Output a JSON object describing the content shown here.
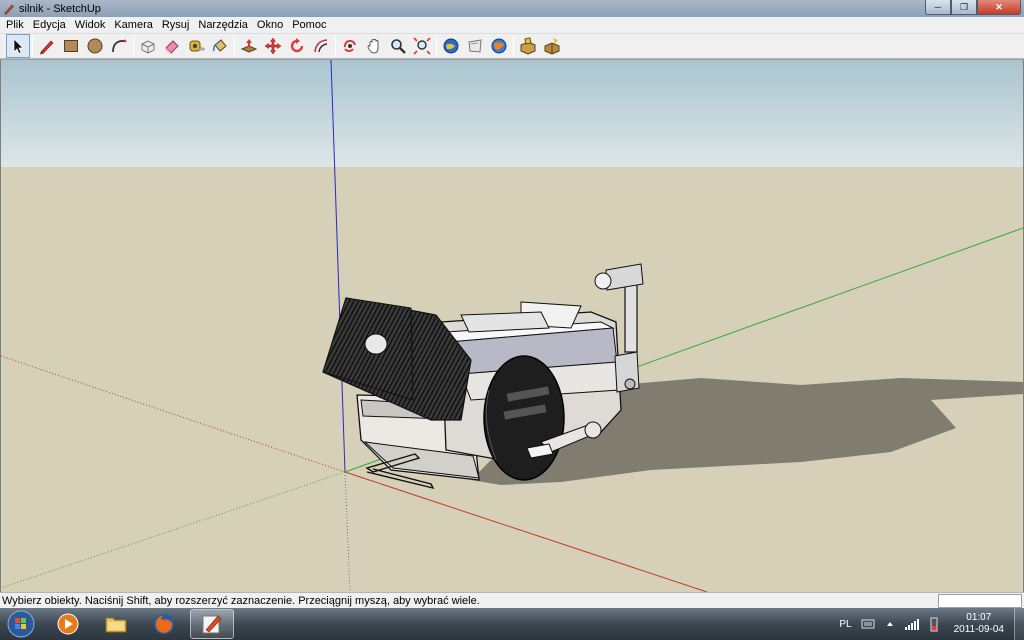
{
  "window": {
    "title": "silnik - SketchUp",
    "app_icon": "sketchup-pencil-icon",
    "controls": [
      "minimize-icon",
      "maximize-icon",
      "close-icon"
    ]
  },
  "menu": [
    {
      "name": "menu-plik",
      "label": "Plik"
    },
    {
      "name": "menu-edycja",
      "label": "Edycja"
    },
    {
      "name": "menu-widok",
      "label": "Widok"
    },
    {
      "name": "menu-kamera",
      "label": "Kamera"
    },
    {
      "name": "menu-rysuj",
      "label": "Rysuj"
    },
    {
      "name": "menu-narzedzia",
      "label": "Narzędzia"
    },
    {
      "name": "menu-okno",
      "label": "Okno"
    },
    {
      "name": "menu-pomoc",
      "label": "Pomoc"
    }
  ],
  "toolbar": {
    "tools": [
      "select-icon",
      "pencil-line-icon",
      "rectangle-icon",
      "circle-icon",
      "arc-icon",
      "make-component-icon",
      "eraser-icon",
      "tape-measure-icon",
      "paint-bucket-icon",
      "push-pull-icon",
      "move-icon",
      "rotate-icon",
      "offset-icon",
      "orbit-icon",
      "pan-icon",
      "zoom-icon",
      "zoom-extents-icon",
      "get-models-icon",
      "share-model-icon",
      "google-earth-icon",
      "components-icon",
      "sandbox-icon"
    ],
    "active_tool": "select-icon"
  },
  "viewport": {
    "sky_color": "#c5d5dc",
    "ground_color": "#d6d0b8",
    "axis_colors": {
      "red": "#c23a2a",
      "green": "#3aa83a",
      "blue": "#2a2ac2"
    },
    "model": "engine-model"
  },
  "status": {
    "text": "Wybierz obiekty. Naciśnij Shift, aby rozszerzyć zaznaczenie. Przeciągnij myszą, aby wybrać wiele."
  },
  "taskbar": {
    "buttons": [
      "start-orb-icon",
      "media-player-icon",
      "file-explorer-icon",
      "firefox-icon",
      "sketchup-icon"
    ],
    "active_button": "sketchup-icon",
    "language": "PL",
    "time": "01:07",
    "date": "2011-09-04"
  }
}
